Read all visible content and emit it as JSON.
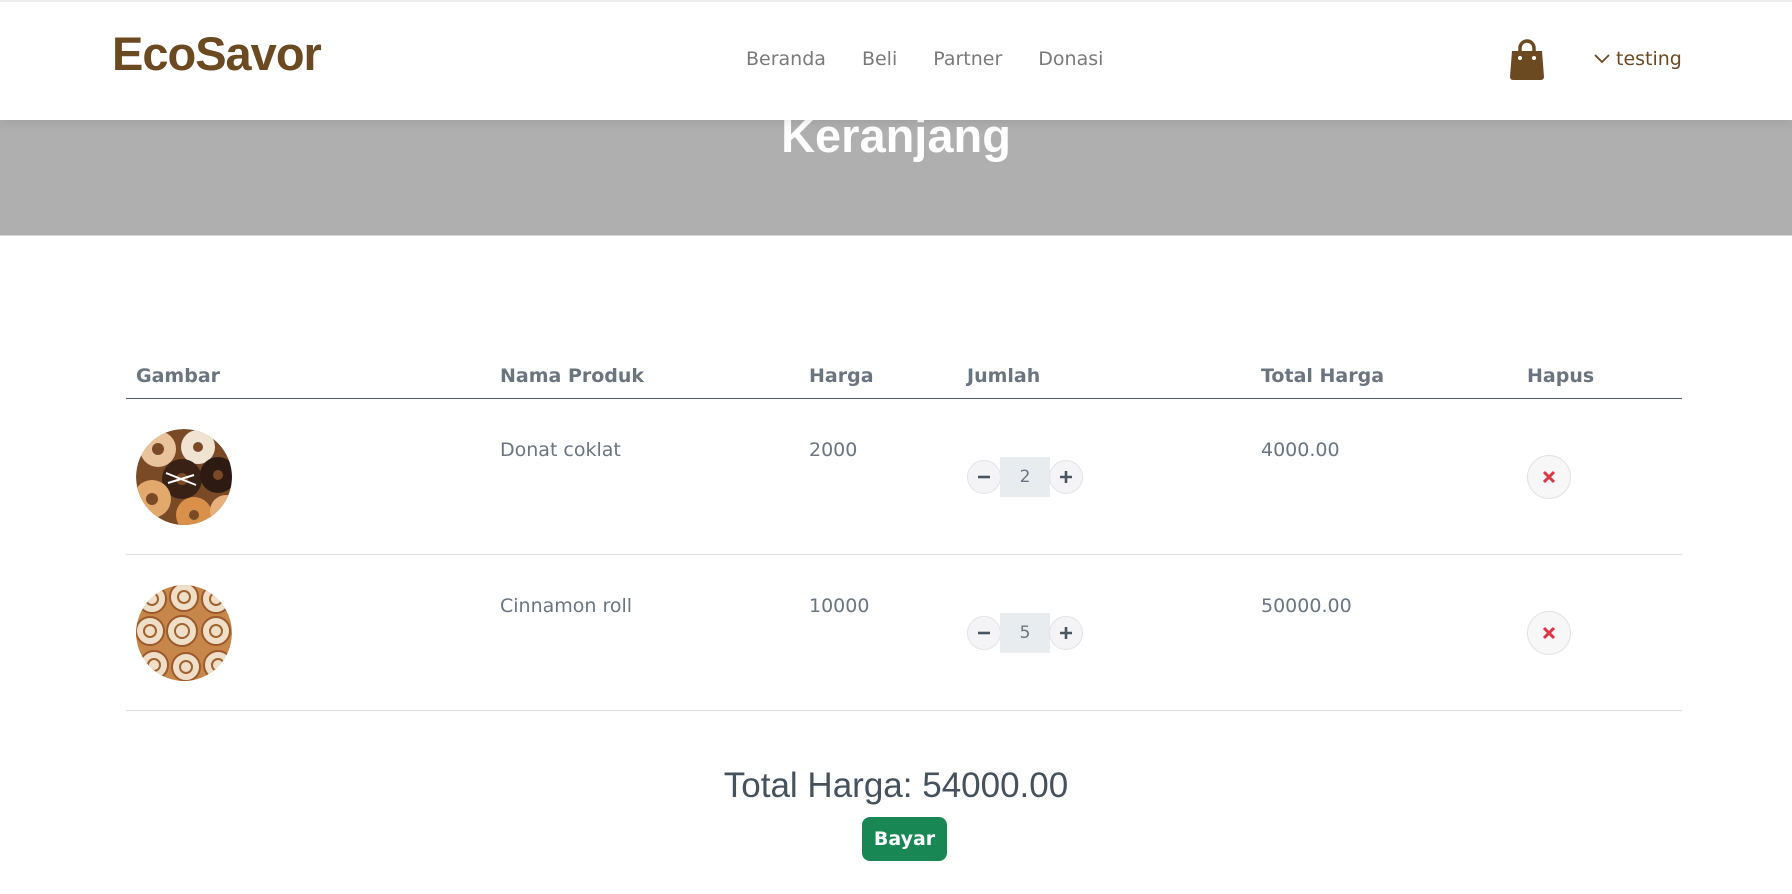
{
  "brand": "EcoSavor",
  "nav": [
    "Beranda",
    "Beli",
    "Partner",
    "Donasi"
  ],
  "icons": {
    "cart": "shopping-bag-icon",
    "user_menu": "chevron-down-icon",
    "minus": "minus-icon",
    "plus": "plus-icon",
    "delete": "close-icon"
  },
  "user": {
    "name": "testing"
  },
  "page_title": "Keranjang",
  "table": {
    "headers": [
      "Gambar",
      "Nama Produk",
      "Harga",
      "Jumlah",
      "Total Harga",
      "Hapus"
    ],
    "rows": [
      {
        "image": "donut-image",
        "name": "Donat coklat",
        "price": "2000",
        "qty": "2",
        "total": "4000.00"
      },
      {
        "image": "cinnamon-roll-image",
        "name": "Cinnamon roll",
        "price": "10000",
        "qty": "5",
        "total": "50000.00"
      }
    ]
  },
  "summary": {
    "label": "Total Harga:",
    "value": "54000.00"
  },
  "pay_button": "Bayar",
  "colors": {
    "brand": "#6c4a21",
    "hero": "#afafaf",
    "pay_button": "#198754",
    "delete_icon": "#dc3545",
    "text_muted": "#6b7580"
  }
}
